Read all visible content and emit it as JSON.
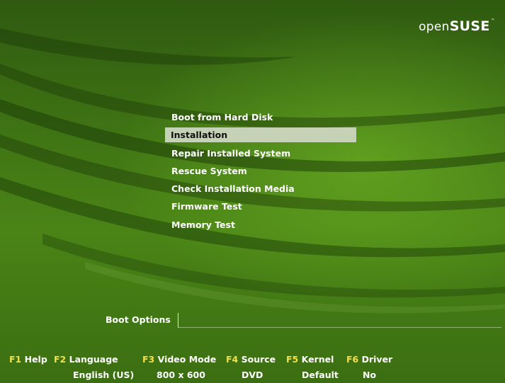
{
  "brand": {
    "prefix": "open",
    "name": "SUSE",
    "mark": "™"
  },
  "menu": {
    "selected_index": 1,
    "items": [
      {
        "label": "Boot from Hard Disk"
      },
      {
        "label": "Installation"
      },
      {
        "label": "Repair Installed System"
      },
      {
        "label": "Rescue System"
      },
      {
        "label": "Check Installation Media"
      },
      {
        "label": "Firmware Test"
      },
      {
        "label": "Memory Test"
      }
    ]
  },
  "boot_options": {
    "label": "Boot Options",
    "value": ""
  },
  "function_keys": [
    {
      "key": "F1",
      "name": "Help",
      "value": ""
    },
    {
      "key": "F2",
      "name": "Language",
      "value": "English (US)"
    },
    {
      "key": "F3",
      "name": "Video Mode",
      "value": "800 x 600"
    },
    {
      "key": "F4",
      "name": "Source",
      "value": "DVD"
    },
    {
      "key": "F5",
      "name": "Kernel",
      "value": "Default"
    },
    {
      "key": "F6",
      "name": "Driver",
      "value": "No"
    }
  ],
  "colors": {
    "background": "#3f7414",
    "highlight": "#c5d2b6",
    "key_label": "#f2e14a",
    "text": "#ffffff"
  }
}
